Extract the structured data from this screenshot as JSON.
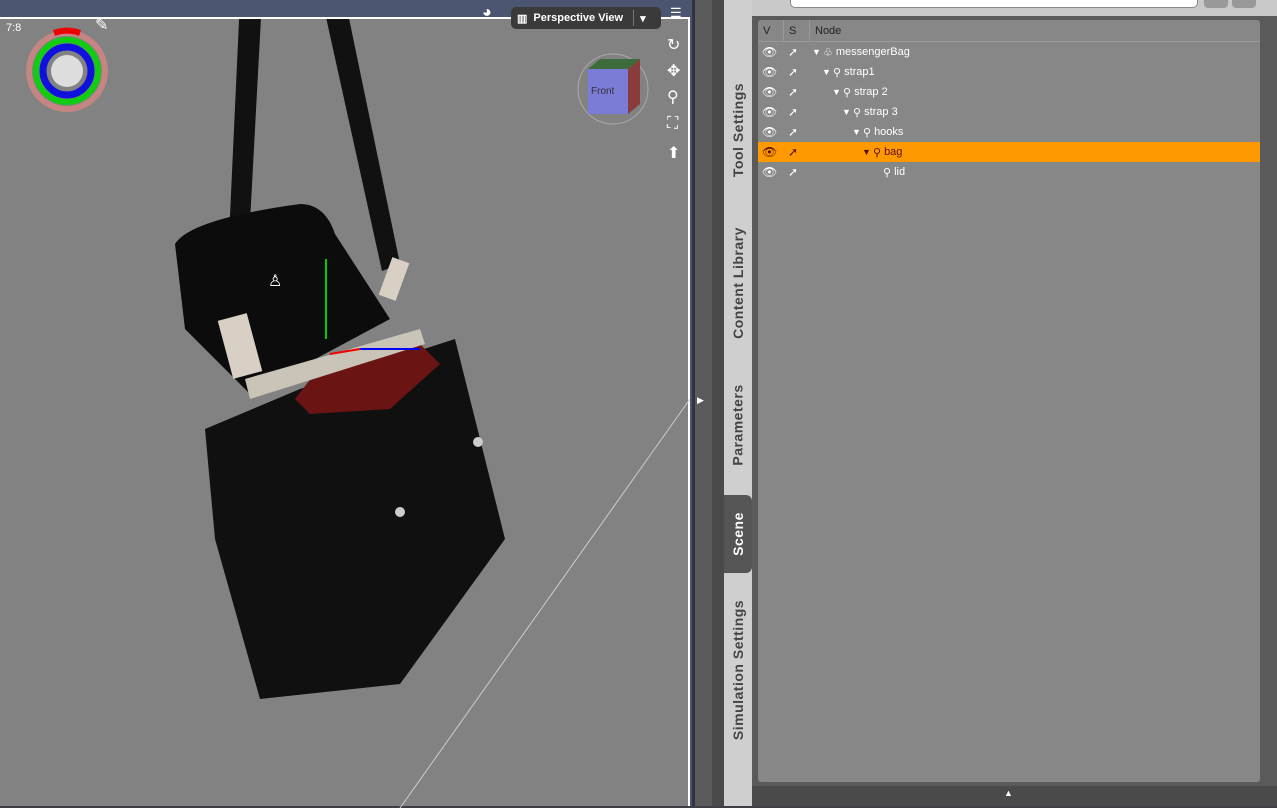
{
  "viewport": {
    "title": "Perspective View",
    "overlay_text": "7:8",
    "cube_label": "Front"
  },
  "side_tabs": [
    {
      "label": "Tool Settings",
      "active": false
    },
    {
      "label": "Content Library",
      "active": false
    },
    {
      "label": "Parameters",
      "active": false
    },
    {
      "label": "Scene",
      "active": true
    },
    {
      "label": "Simulation Settings",
      "active": false
    }
  ],
  "scene_tree": {
    "columns": [
      "V",
      "S",
      "Node"
    ],
    "nodes": [
      {
        "name": "messengerBag",
        "depth": 0,
        "type": "figure",
        "expanded": true,
        "selected": false
      },
      {
        "name": "strap1",
        "depth": 1,
        "type": "bone",
        "expanded": true,
        "selected": false
      },
      {
        "name": "strap 2",
        "depth": 2,
        "type": "bone",
        "expanded": true,
        "selected": false
      },
      {
        "name": "strap 3",
        "depth": 3,
        "type": "bone",
        "expanded": true,
        "selected": false
      },
      {
        "name": "hooks",
        "depth": 4,
        "type": "bone",
        "expanded": true,
        "selected": false
      },
      {
        "name": "bag",
        "depth": 5,
        "type": "bone",
        "expanded": true,
        "selected": true
      },
      {
        "name": "lid",
        "depth": 6,
        "type": "bone",
        "expanded": false,
        "selected": false
      }
    ]
  },
  "colors": {
    "selection": "#ff9900",
    "viewport_bg": "#828282"
  }
}
